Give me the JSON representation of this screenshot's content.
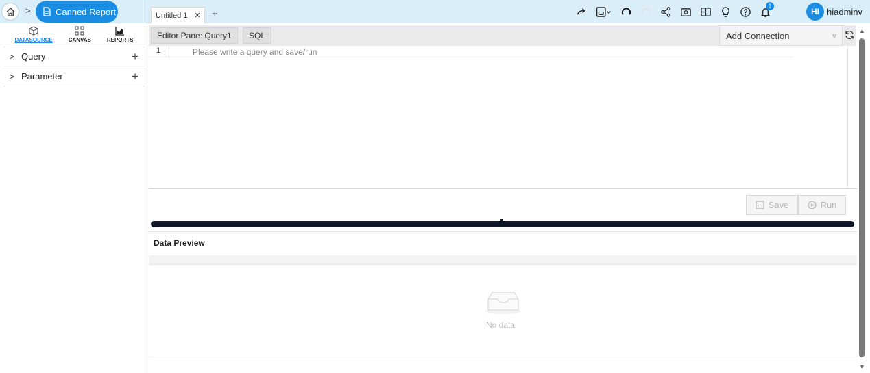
{
  "breadcrumb": {
    "chevron": ">",
    "current": "Canned Report"
  },
  "tabs": [
    {
      "label": "Untitled 1",
      "close": "×"
    }
  ],
  "new_tab": "+",
  "toolbar_icons": [
    "redo-icon",
    "save-icon",
    "undo-icon",
    "reload-icon",
    "share-icon",
    "snapshot-icon",
    "layout-icon",
    "bulb-icon",
    "help-icon",
    "bell-icon"
  ],
  "notifications_count": "1",
  "user": {
    "initials": "HI",
    "name": "hiadmin",
    "caret": "v"
  },
  "sidebar": {
    "tabs": [
      {
        "label": "DATASOURCE",
        "icon": "cube-icon",
        "active": true
      },
      {
        "label": "CANVAS",
        "icon": "canvas-icon",
        "active": false
      },
      {
        "label": "REPORTS",
        "icon": "bar-chart-icon",
        "active": false
      }
    ],
    "sections": [
      {
        "label": "Query",
        "chevron": ">",
        "plus": "+"
      },
      {
        "label": "Parameter",
        "chevron": ">",
        "plus": "+"
      }
    ]
  },
  "editor": {
    "pane_label": "Editor Pane: Query1",
    "lang": "SQL",
    "connection_placeholder": "Add Connection",
    "connection_caret": "v",
    "line_number": "1",
    "placeholder": "Please write a query and save/run",
    "save_label": "Save",
    "run_label": "Run"
  },
  "preview": {
    "title": "Data Preview",
    "empty_text": "No data"
  },
  "colors": {
    "accent": "#1a8de3",
    "topbar": "#daeef9",
    "splitter": "#0d1626"
  }
}
